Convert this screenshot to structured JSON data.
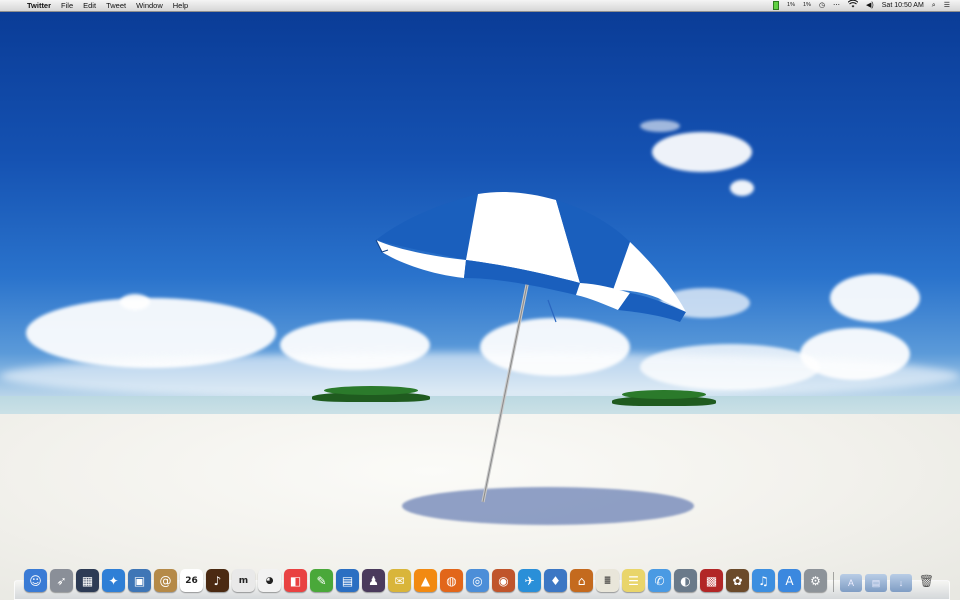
{
  "menubar": {
    "apple_glyph": "",
    "app_name": "Twitter",
    "menus": [
      "File",
      "Edit",
      "Tweet",
      "Window",
      "Help"
    ],
    "status": {
      "cpu1": "1%",
      "cpu2": "1%",
      "clock": "Sat 10:50 AM"
    },
    "icons": [
      "battery-icon",
      "timemachine-icon",
      "bluetooth-icon",
      "wifi-icon",
      "volume-icon",
      "spotlight-icon",
      "notification-list-icon"
    ]
  },
  "desktop": {
    "wallpaper": "beach-umbrella",
    "colors": {
      "sky": "#1552b2",
      "umbrella_blue": "#1a5fbd",
      "umbrella_white": "#ffffff",
      "sand": "#f2f1ec"
    }
  },
  "dock": {
    "apps": [
      {
        "name": "Finder",
        "glyph": "☺",
        "color": "#3a7bd5"
      },
      {
        "name": "Launchpad",
        "glyph": "➶",
        "color": "#8a8f98"
      },
      {
        "name": "Mission Control",
        "glyph": "▦",
        "color": "#2d3b55"
      },
      {
        "name": "Safari",
        "glyph": "✦",
        "color": "#2f7fd6"
      },
      {
        "name": "Preview",
        "glyph": "▣",
        "color": "#3f76b6"
      },
      {
        "name": "Contacts",
        "glyph": "@",
        "color": "#b58a48"
      },
      {
        "name": "Calendar",
        "glyph": "26",
        "color": "#ffffff"
      },
      {
        "name": "iTunes Visualizer",
        "glyph": "♪",
        "color": "#4b2a12"
      },
      {
        "name": "Mailplane",
        "glyph": "m",
        "color": "#e9e9e9"
      },
      {
        "name": "Panda",
        "glyph": "◕",
        "color": "#f2f2f2"
      },
      {
        "name": "Fantastical",
        "glyph": "◧",
        "color": "#e94242"
      },
      {
        "name": "Evernote",
        "glyph": "✎",
        "color": "#4aa83a"
      },
      {
        "name": "Disk Utility",
        "glyph": "▤",
        "color": "#2b6fc2"
      },
      {
        "name": "Alfred",
        "glyph": "♟",
        "color": "#4a3a5c"
      },
      {
        "name": "Stickies",
        "glyph": "✉",
        "color": "#d9b53a"
      },
      {
        "name": "VLC",
        "glyph": "▲",
        "color": "#f28a12"
      },
      {
        "name": "Firefox",
        "glyph": "◍",
        "color": "#e2661a"
      },
      {
        "name": "Chrome",
        "glyph": "◎",
        "color": "#4c8ed8"
      },
      {
        "name": "Aperture",
        "glyph": "◉",
        "color": "#c0552c"
      },
      {
        "name": "Twitter",
        "glyph": "✈",
        "color": "#2a8fd8"
      },
      {
        "name": "Tweetie",
        "glyph": "♦",
        "color": "#3c77c4"
      },
      {
        "name": "Cloud App",
        "glyph": "⌂",
        "color": "#c46a1e"
      },
      {
        "name": "TextEdit",
        "glyph": "≣",
        "color": "#e9e6da"
      },
      {
        "name": "Notes",
        "glyph": "☰",
        "color": "#e9d56a"
      },
      {
        "name": "Messages",
        "glyph": "✆",
        "color": "#4a9ae3"
      },
      {
        "name": "Screen Sharing",
        "glyph": "◐",
        "color": "#6a7a8a"
      },
      {
        "name": "Photo Booth",
        "glyph": "▩",
        "color": "#b22727"
      },
      {
        "name": "iPhoto",
        "glyph": "✿",
        "color": "#6b4a2a"
      },
      {
        "name": "iTunes",
        "glyph": "♫",
        "color": "#3d8fe0"
      },
      {
        "name": "App Store",
        "glyph": "A",
        "color": "#3b88df"
      },
      {
        "name": "System Preferences",
        "glyph": "⚙",
        "color": "#8d9399"
      }
    ],
    "stacks": [
      {
        "name": "Applications",
        "glyph": "A"
      },
      {
        "name": "Documents",
        "glyph": "▤"
      },
      {
        "name": "Downloads",
        "glyph": "↓"
      }
    ],
    "trash": {
      "name": "Trash",
      "glyph": "🗑"
    }
  }
}
